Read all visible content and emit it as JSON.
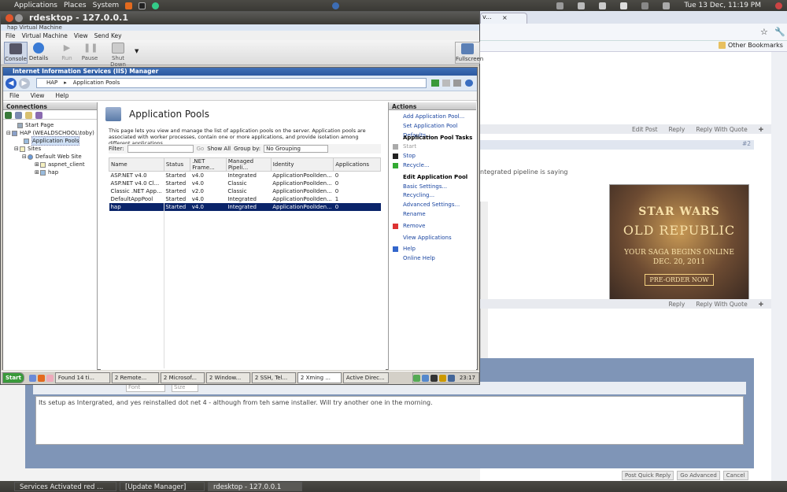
{
  "top_panel": {
    "applications": "Applications",
    "places": "Places",
    "system": "System",
    "datetime": "Tue 13 Dec, 11:19 PM"
  },
  "rdesktop": {
    "title": "rdesktop - 127.0.0.1"
  },
  "hyperv": {
    "title": "hap Virtual Machine",
    "menu": [
      "File",
      "Virtual Machine",
      "View",
      "Send Key"
    ],
    "tools": [
      "Console",
      "Details",
      "Run",
      "Pause",
      "Shut Down"
    ],
    "fullscreen": "Fullscreen"
  },
  "iis": {
    "title": "Internet Information Services (IIS) Manager",
    "breadcrumb": [
      "HAP",
      "Application Pools"
    ],
    "menu": [
      "File",
      "View",
      "Help"
    ],
    "connections": {
      "header": "Connections",
      "tree": [
        "Start Page",
        "HAP (WEALDSCHOOL\\toby)",
        "Application Pools",
        "Sites",
        "Default Web Site",
        "aspnet_client",
        "hap"
      ]
    },
    "center": {
      "title": "Application Pools",
      "description": "This page lets you view and manage the list of application pools on the server. Application pools are associated with worker processes, contain one or more applications, and provide isolation among different applications.",
      "filter_label": "Filter:",
      "go": "Go",
      "show_all": "Show All",
      "group_by": "Group by:",
      "group_value": "No Grouping",
      "columns": [
        "Name",
        "Status",
        ".NET Frame...",
        "Managed Pipeli...",
        "Identity",
        "Applications"
      ],
      "rows": [
        [
          "ASP.NET v4.0",
          "Started",
          "v4.0",
          "Integrated",
          "ApplicationPoolIden...",
          "0"
        ],
        [
          "ASP.NET v4.0 Cl...",
          "Started",
          "v4.0",
          "Classic",
          "ApplicationPoolIden...",
          "0"
        ],
        [
          "Classic .NET App...",
          "Started",
          "v2.0",
          "Classic",
          "ApplicationPoolIden...",
          "0"
        ],
        [
          "DefaultAppPool",
          "Started",
          "v4.0",
          "Integrated",
          "ApplicationPoolIden...",
          "1"
        ],
        [
          "hap",
          "Started",
          "v4.0",
          "Integrated",
          "ApplicationPoolIden...",
          "0"
        ]
      ]
    },
    "actions": {
      "header": "Actions",
      "items": [
        {
          "label": "Add Application Pool...",
          "kind": "link"
        },
        {
          "label": "Set Application Pool Defaults...",
          "kind": "link"
        },
        {
          "label": "Application Pool Tasks",
          "kind": "head"
        },
        {
          "label": "Start",
          "kind": "dis"
        },
        {
          "label": "Stop",
          "kind": "link"
        },
        {
          "label": "Recycle...",
          "kind": "link"
        },
        {
          "label": "Edit Application Pool",
          "kind": "head"
        },
        {
          "label": "Basic Settings...",
          "kind": "link"
        },
        {
          "label": "Recycling...",
          "kind": "link"
        },
        {
          "label": "Advanced Settings...",
          "kind": "link"
        },
        {
          "label": "Rename",
          "kind": "link"
        },
        {
          "label": "Remove",
          "kind": "link"
        },
        {
          "label": "View Applications",
          "kind": "link"
        },
        {
          "label": "Help",
          "kind": "link"
        },
        {
          "label": "Online Help",
          "kind": "link"
        }
      ]
    }
  },
  "xp_taskbar": {
    "start": "Start",
    "items": [
      "Found 14 ti...",
      "2 Remote...",
      "2 Microsof...",
      "2 Window...",
      "2 SSH, Tel...",
      "2 Xming ...",
      "Active Direc..."
    ],
    "clock": "23:17"
  },
  "browser": {
    "bookmarks": "Other Bookmarks",
    "edit_post": "Edit Post",
    "reply": "Reply",
    "reply_quote": "Reply With Quote",
    "post_num": "#2",
    "snippet": "ntegrated pipeline is saying"
  },
  "ad": {
    "l1": "STAR WARS",
    "l2": "OLD REPUBLIC",
    "l3": "YOUR SAGA BEGINS ONLINE",
    "l4": "DEC. 20, 2011",
    "cta": "PRE-ORDER NOW"
  },
  "editor": {
    "text": "Its setup as Intergrated, and yes reinstalled dot net 4 - although from teh same installer. Will try another one in the morning.",
    "font": "Font",
    "size": "Size",
    "post_quick": "Post Quick Reply",
    "go_advanced": "Go Advanced",
    "cancel": "Cancel"
  },
  "bottom_panel": {
    "tasks": [
      "Services Activated red ...",
      "[Update Manager]",
      "rdesktop - 127.0.0.1"
    ]
  }
}
